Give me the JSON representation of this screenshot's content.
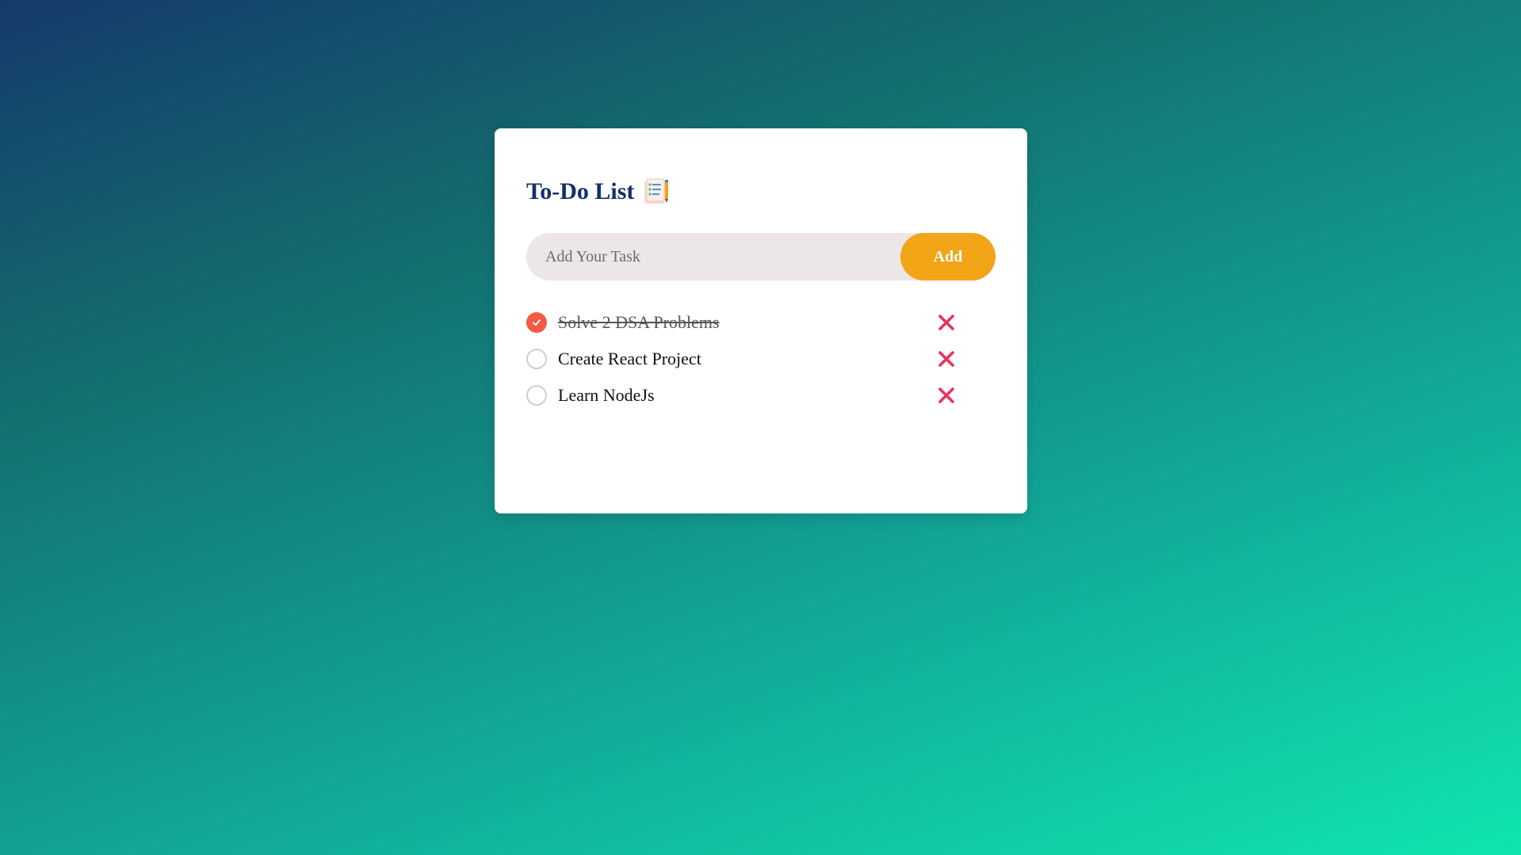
{
  "app": {
    "title": "To-Do List",
    "title_icon": "notepad-list-icon"
  },
  "input": {
    "placeholder": "Add Your Task",
    "value": "",
    "add_label": "Add"
  },
  "tasks": [
    {
      "text": "Solve 2 DSA Problems",
      "done": true
    },
    {
      "text": "Create React Project",
      "done": false
    },
    {
      "text": "Learn NodeJs",
      "done": false
    }
  ],
  "icons": {
    "check": "checkmark-icon",
    "delete": "close-icon"
  },
  "colors": {
    "accent": "#f2a516",
    "checked": "#f45a45",
    "delete": "#e8335f",
    "title": "#12306b"
  }
}
